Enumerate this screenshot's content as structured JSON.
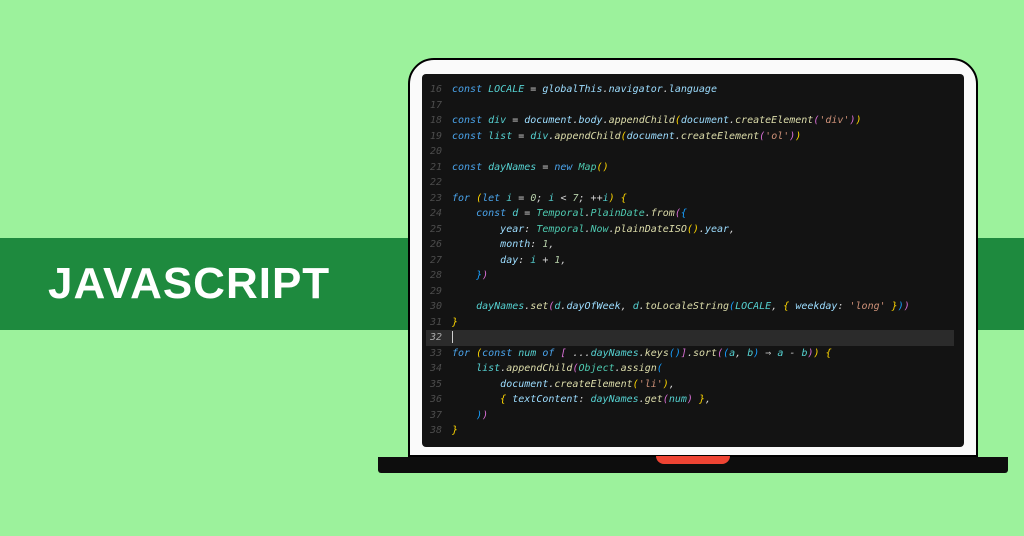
{
  "banner": {
    "title": "JAVASCRIPT"
  },
  "editor": {
    "highlighted_line": 32,
    "lines": [
      {
        "n": 16,
        "tokens": [
          [
            "kw",
            "const"
          ],
          [
            "op",
            " "
          ],
          [
            "var",
            "LOCALE"
          ],
          [
            "op",
            " = "
          ],
          [
            "pr",
            "globalThis"
          ],
          [
            "op",
            "."
          ],
          [
            "pr",
            "navigator"
          ],
          [
            "op",
            "."
          ],
          [
            "pr",
            "language"
          ]
        ]
      },
      {
        "n": 17,
        "tokens": []
      },
      {
        "n": 18,
        "tokens": [
          [
            "kw",
            "const"
          ],
          [
            "op",
            " "
          ],
          [
            "var",
            "div"
          ],
          [
            "op",
            " = "
          ],
          [
            "pr",
            "document"
          ],
          [
            "op",
            "."
          ],
          [
            "pr",
            "body"
          ],
          [
            "op",
            "."
          ],
          [
            "fn",
            "appendChild"
          ],
          [
            "br1",
            "("
          ],
          [
            "pr",
            "document"
          ],
          [
            "op",
            "."
          ],
          [
            "fn",
            "createElement"
          ],
          [
            "br2",
            "("
          ],
          [
            "str",
            "'div'"
          ],
          [
            "br2",
            ")"
          ],
          [
            "br1",
            ")"
          ]
        ]
      },
      {
        "n": 19,
        "tokens": [
          [
            "kw",
            "const"
          ],
          [
            "op",
            " "
          ],
          [
            "var",
            "list"
          ],
          [
            "op",
            " = "
          ],
          [
            "var",
            "div"
          ],
          [
            "op",
            "."
          ],
          [
            "fn",
            "appendChild"
          ],
          [
            "br1",
            "("
          ],
          [
            "pr",
            "document"
          ],
          [
            "op",
            "."
          ],
          [
            "fn",
            "createElement"
          ],
          [
            "br2",
            "("
          ],
          [
            "str",
            "'ol'"
          ],
          [
            "br2",
            ")"
          ],
          [
            "br1",
            ")"
          ]
        ]
      },
      {
        "n": 20,
        "tokens": []
      },
      {
        "n": 21,
        "tokens": [
          [
            "kw",
            "const"
          ],
          [
            "op",
            " "
          ],
          [
            "var",
            "dayNames"
          ],
          [
            "op",
            " = "
          ],
          [
            "kw",
            "new"
          ],
          [
            "op",
            " "
          ],
          [
            "obj",
            "Map"
          ],
          [
            "br1",
            "("
          ],
          [
            "br1",
            ")"
          ]
        ]
      },
      {
        "n": 22,
        "tokens": []
      },
      {
        "n": 23,
        "tokens": [
          [
            "kw",
            "for"
          ],
          [
            "op",
            " "
          ],
          [
            "br1",
            "("
          ],
          [
            "kw",
            "let"
          ],
          [
            "op",
            " "
          ],
          [
            "var",
            "i"
          ],
          [
            "op",
            " = "
          ],
          [
            "num",
            "0"
          ],
          [
            "op",
            "; "
          ],
          [
            "var",
            "i"
          ],
          [
            "op",
            " < "
          ],
          [
            "num",
            "7"
          ],
          [
            "op",
            "; ++"
          ],
          [
            "var",
            "i"
          ],
          [
            "br1",
            ")"
          ],
          [
            "op",
            " "
          ],
          [
            "br1",
            "{"
          ]
        ]
      },
      {
        "n": 24,
        "tokens": [
          [
            "op",
            "    "
          ],
          [
            "kw",
            "const"
          ],
          [
            "op",
            " "
          ],
          [
            "var",
            "d"
          ],
          [
            "op",
            " = "
          ],
          [
            "obj",
            "Temporal"
          ],
          [
            "op",
            "."
          ],
          [
            "obj",
            "PlainDate"
          ],
          [
            "op",
            "."
          ],
          [
            "fn",
            "from"
          ],
          [
            "br2",
            "("
          ],
          [
            "br3",
            "{"
          ]
        ]
      },
      {
        "n": 25,
        "tokens": [
          [
            "op",
            "        "
          ],
          [
            "pr",
            "year"
          ],
          [
            "op",
            ": "
          ],
          [
            "obj",
            "Temporal"
          ],
          [
            "op",
            "."
          ],
          [
            "obj",
            "Now"
          ],
          [
            "op",
            "."
          ],
          [
            "fn",
            "plainDateISO"
          ],
          [
            "br1",
            "("
          ],
          [
            "br1",
            ")"
          ],
          [
            "op",
            "."
          ],
          [
            "pr",
            "year"
          ],
          [
            "op",
            ","
          ]
        ]
      },
      {
        "n": 26,
        "tokens": [
          [
            "op",
            "        "
          ],
          [
            "pr",
            "month"
          ],
          [
            "op",
            ": "
          ],
          [
            "num",
            "1"
          ],
          [
            "op",
            ","
          ]
        ]
      },
      {
        "n": 27,
        "tokens": [
          [
            "op",
            "        "
          ],
          [
            "pr",
            "day"
          ],
          [
            "op",
            ": "
          ],
          [
            "var",
            "i"
          ],
          [
            "op",
            " + "
          ],
          [
            "num",
            "1"
          ],
          [
            "op",
            ","
          ]
        ]
      },
      {
        "n": 28,
        "tokens": [
          [
            "op",
            "    "
          ],
          [
            "br3",
            "}"
          ],
          [
            "br2",
            ")"
          ]
        ]
      },
      {
        "n": 29,
        "tokens": []
      },
      {
        "n": 30,
        "tokens": [
          [
            "op",
            "    "
          ],
          [
            "var",
            "dayNames"
          ],
          [
            "op",
            "."
          ],
          [
            "fn",
            "set"
          ],
          [
            "br2",
            "("
          ],
          [
            "var",
            "d"
          ],
          [
            "op",
            "."
          ],
          [
            "pr",
            "dayOfWeek"
          ],
          [
            "op",
            ", "
          ],
          [
            "var",
            "d"
          ],
          [
            "op",
            "."
          ],
          [
            "fn",
            "toLocaleString"
          ],
          [
            "br3",
            "("
          ],
          [
            "var",
            "LOCALE"
          ],
          [
            "op",
            ", "
          ],
          [
            "br1",
            "{"
          ],
          [
            "op",
            " "
          ],
          [
            "pr",
            "weekday"
          ],
          [
            "op",
            ": "
          ],
          [
            "str",
            "'long'"
          ],
          [
            "op",
            " "
          ],
          [
            "br1",
            "}"
          ],
          [
            "br3",
            ")"
          ],
          [
            "br2",
            ")"
          ]
        ]
      },
      {
        "n": 31,
        "tokens": [
          [
            "br1",
            "}"
          ]
        ]
      },
      {
        "n": 32,
        "tokens": []
      },
      {
        "n": 33,
        "tokens": [
          [
            "kw",
            "for"
          ],
          [
            "op",
            " "
          ],
          [
            "br1",
            "("
          ],
          [
            "kw",
            "const"
          ],
          [
            "op",
            " "
          ],
          [
            "var",
            "num"
          ],
          [
            "op",
            " "
          ],
          [
            "kw",
            "of"
          ],
          [
            "op",
            " "
          ],
          [
            "br2",
            "["
          ],
          [
            "op",
            " ..."
          ],
          [
            "var",
            "dayNames"
          ],
          [
            "op",
            "."
          ],
          [
            "fn",
            "keys"
          ],
          [
            "br3",
            "("
          ],
          [
            "br3",
            ")"
          ],
          [
            "br2",
            "]"
          ],
          [
            "op",
            "."
          ],
          [
            "fn",
            "sort"
          ],
          [
            "br2",
            "("
          ],
          [
            "br3",
            "("
          ],
          [
            "var",
            "a"
          ],
          [
            "op",
            ", "
          ],
          [
            "var",
            "b"
          ],
          [
            "br3",
            ")"
          ],
          [
            "op",
            " ⇒ "
          ],
          [
            "var",
            "a"
          ],
          [
            "op",
            " - "
          ],
          [
            "var",
            "b"
          ],
          [
            "br2",
            ")"
          ],
          [
            "br1",
            ")"
          ],
          [
            "op",
            " "
          ],
          [
            "br1",
            "{"
          ]
        ]
      },
      {
        "n": 34,
        "tokens": [
          [
            "op",
            "    "
          ],
          [
            "var",
            "list"
          ],
          [
            "op",
            "."
          ],
          [
            "fn",
            "appendChild"
          ],
          [
            "br2",
            "("
          ],
          [
            "obj",
            "Object"
          ],
          [
            "op",
            "."
          ],
          [
            "fn",
            "assign"
          ],
          [
            "br3",
            "("
          ]
        ]
      },
      {
        "n": 35,
        "tokens": [
          [
            "op",
            "        "
          ],
          [
            "pr",
            "document"
          ],
          [
            "op",
            "."
          ],
          [
            "fn",
            "createElement"
          ],
          [
            "br1",
            "("
          ],
          [
            "str",
            "'li'"
          ],
          [
            "br1",
            ")"
          ],
          [
            "op",
            ","
          ]
        ]
      },
      {
        "n": 36,
        "tokens": [
          [
            "op",
            "        "
          ],
          [
            "br1",
            "{"
          ],
          [
            "op",
            " "
          ],
          [
            "pr",
            "textContent"
          ],
          [
            "op",
            ": "
          ],
          [
            "var",
            "dayNames"
          ],
          [
            "op",
            "."
          ],
          [
            "fn",
            "get"
          ],
          [
            "br2",
            "("
          ],
          [
            "var",
            "num"
          ],
          [
            "br2",
            ")"
          ],
          [
            "op",
            " "
          ],
          [
            "br1",
            "}"
          ],
          [
            "op",
            ","
          ]
        ]
      },
      {
        "n": 37,
        "tokens": [
          [
            "op",
            "    "
          ],
          [
            "br3",
            ")"
          ],
          [
            "br2",
            ")"
          ]
        ]
      },
      {
        "n": 38,
        "tokens": [
          [
            "br1",
            "}"
          ]
        ]
      }
    ]
  }
}
